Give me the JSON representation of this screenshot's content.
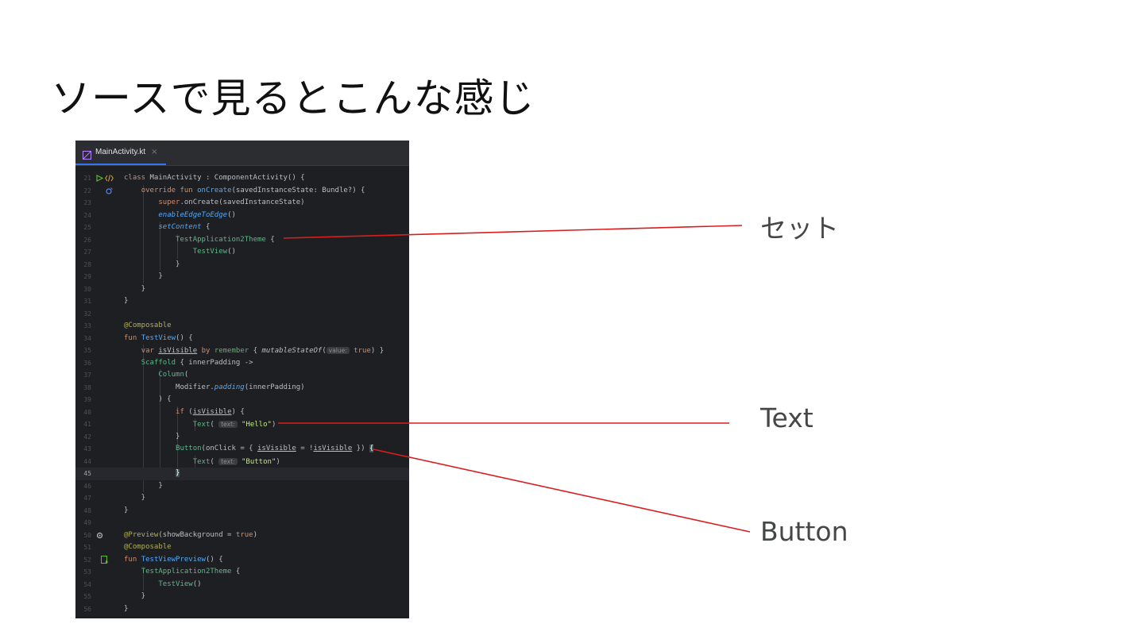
{
  "slide": {
    "title": "ソースで見るとこんな感じ"
  },
  "editor": {
    "tab": {
      "label": "MainActivity.kt",
      "close": "×"
    },
    "current_line": 45,
    "lines": [
      {
        "n": "21",
        "segs": [
          [
            "kw",
            "class "
          ],
          [
            "",
            "MainActivity : ComponentActivity() {"
          ]
        ]
      },
      {
        "n": "22",
        "segs": [
          [
            "",
            "    "
          ],
          [
            "kw",
            "override fun "
          ],
          [
            "fn",
            "onCreate"
          ],
          [
            "",
            "(savedInstanceState: Bundle?) {"
          ]
        ]
      },
      {
        "n": "23",
        "segs": [
          [
            "",
            "        "
          ],
          [
            "kw",
            "super"
          ],
          [
            "",
            ".onCreate(savedInstanceState)"
          ]
        ]
      },
      {
        "n": "24",
        "segs": [
          [
            "",
            "        "
          ],
          [
            "it",
            "enableEdgeToEdge"
          ],
          [
            "",
            "()"
          ]
        ]
      },
      {
        "n": "25",
        "segs": [
          [
            "",
            "        "
          ],
          [
            "it",
            "setContent"
          ],
          [
            "",
            " {"
          ]
        ]
      },
      {
        "n": "26",
        "segs": [
          [
            "",
            "            "
          ],
          [
            "cmp",
            "TestApplication2Theme"
          ],
          [
            "",
            " {"
          ]
        ]
      },
      {
        "n": "27",
        "segs": [
          [
            "",
            "                "
          ],
          [
            "cmp",
            "TestView"
          ],
          [
            "",
            "()"
          ]
        ]
      },
      {
        "n": "28",
        "segs": [
          [
            "",
            "            }"
          ]
        ]
      },
      {
        "n": "29",
        "segs": [
          [
            "",
            "        }"
          ]
        ]
      },
      {
        "n": "30",
        "segs": [
          [
            "",
            "    }"
          ]
        ]
      },
      {
        "n": "31",
        "segs": [
          [
            "",
            "}"
          ]
        ]
      },
      {
        "n": "32",
        "segs": []
      },
      {
        "n": "33",
        "segs": [
          [
            "ann",
            "@Composable"
          ]
        ]
      },
      {
        "n": "34",
        "segs": [
          [
            "kw",
            "fun "
          ],
          [
            "fn",
            "TestView"
          ],
          [
            "",
            "() {"
          ]
        ]
      },
      {
        "n": "35",
        "segs": [
          [
            "",
            "    "
          ],
          [
            "kw",
            "var "
          ],
          [
            "und",
            "isVisible"
          ],
          [
            "kw",
            " by "
          ],
          [
            "cls",
            "remember"
          ],
          [
            "",
            " { "
          ],
          [
            "itw",
            "mutableStateOf"
          ],
          [
            "",
            "("
          ],
          [
            "hint",
            "value:"
          ],
          [
            "kw",
            " true"
          ],
          [
            "",
            ") }"
          ]
        ]
      },
      {
        "n": "36",
        "segs": [
          [
            "",
            "    "
          ],
          [
            "cmp",
            "Scaffold"
          ],
          [
            "",
            " { innerPadding ->"
          ]
        ]
      },
      {
        "n": "37",
        "segs": [
          [
            "",
            "        "
          ],
          [
            "cmp",
            "Column"
          ],
          [
            "",
            "("
          ]
        ]
      },
      {
        "n": "38",
        "segs": [
          [
            "",
            "            Modifier."
          ],
          [
            "it",
            "padding"
          ],
          [
            "",
            "(innerPadding)"
          ]
        ]
      },
      {
        "n": "39",
        "segs": [
          [
            "",
            "        ) {"
          ]
        ]
      },
      {
        "n": "40",
        "segs": [
          [
            "",
            "            "
          ],
          [
            "kw",
            "if "
          ],
          [
            "",
            "("
          ],
          [
            "und",
            "isVisible"
          ],
          [
            "",
            ") {"
          ]
        ]
      },
      {
        "n": "41",
        "segs": [
          [
            "",
            "                "
          ],
          [
            "cmp",
            "Text"
          ],
          [
            "",
            "( "
          ],
          [
            "hint",
            "text:"
          ],
          [
            "str",
            " \"Hello\""
          ],
          [
            "",
            ")"
          ]
        ]
      },
      {
        "n": "42",
        "segs": [
          [
            "",
            "            }"
          ]
        ]
      },
      {
        "n": "43",
        "segs": [
          [
            "",
            "            "
          ],
          [
            "cmp",
            "Button"
          ],
          [
            "",
            "(onClick = { "
          ],
          [
            "und",
            "isVisible"
          ],
          [
            "",
            " = !"
          ],
          [
            "und",
            "isVisible"
          ],
          [
            "",
            " }) "
          ],
          [
            "bh",
            "{"
          ]
        ]
      },
      {
        "n": "44",
        "segs": [
          [
            "",
            "                "
          ],
          [
            "cmp",
            "Text"
          ],
          [
            "",
            "( "
          ],
          [
            "hint",
            "text:"
          ],
          [
            "str",
            " \"Button\""
          ],
          [
            "",
            ")"
          ]
        ]
      },
      {
        "n": "45",
        "segs": [
          [
            "",
            "            "
          ],
          [
            "bh",
            "}"
          ]
        ]
      },
      {
        "n": "46",
        "segs": [
          [
            "",
            "        }"
          ]
        ]
      },
      {
        "n": "47",
        "segs": [
          [
            "",
            "    }"
          ]
        ]
      },
      {
        "n": "48",
        "segs": [
          [
            "",
            "}"
          ]
        ]
      },
      {
        "n": "49",
        "segs": []
      },
      {
        "n": "50",
        "segs": [
          [
            "ann",
            "@Preview"
          ],
          [
            "",
            "(showBackground = "
          ],
          [
            "kw",
            "true"
          ],
          [
            "",
            ")"
          ]
        ]
      },
      {
        "n": "51",
        "segs": [
          [
            "ann",
            "@Composable"
          ]
        ]
      },
      {
        "n": "52",
        "segs": [
          [
            "kw",
            "fun "
          ],
          [
            "fn",
            "TestViewPreview"
          ],
          [
            "",
            "() {"
          ]
        ]
      },
      {
        "n": "53",
        "segs": [
          [
            "",
            "    "
          ],
          [
            "cmp",
            "TestApplication2Theme"
          ],
          [
            "",
            " {"
          ]
        ]
      },
      {
        "n": "54",
        "segs": [
          [
            "",
            "        "
          ],
          [
            "cmp",
            "TestView"
          ],
          [
            "",
            "()"
          ]
        ]
      },
      {
        "n": "55",
        "segs": [
          [
            "",
            "    }"
          ]
        ]
      },
      {
        "n": "56",
        "segs": [
          [
            "",
            "}"
          ]
        ]
      }
    ]
  },
  "callouts": {
    "set": "セット",
    "text": "Text",
    "button": "Button"
  },
  "colors": {
    "accent": "#3574f0",
    "arrow": "#d81e1e",
    "editor_bg": "#1e1f22"
  },
  "icons": {
    "line21": [
      "run-icon",
      "code-icon"
    ],
    "line22": "override-icon",
    "line50": "gear-icon",
    "line52": "preview-icon",
    "tab": "kotlin-file-icon"
  }
}
